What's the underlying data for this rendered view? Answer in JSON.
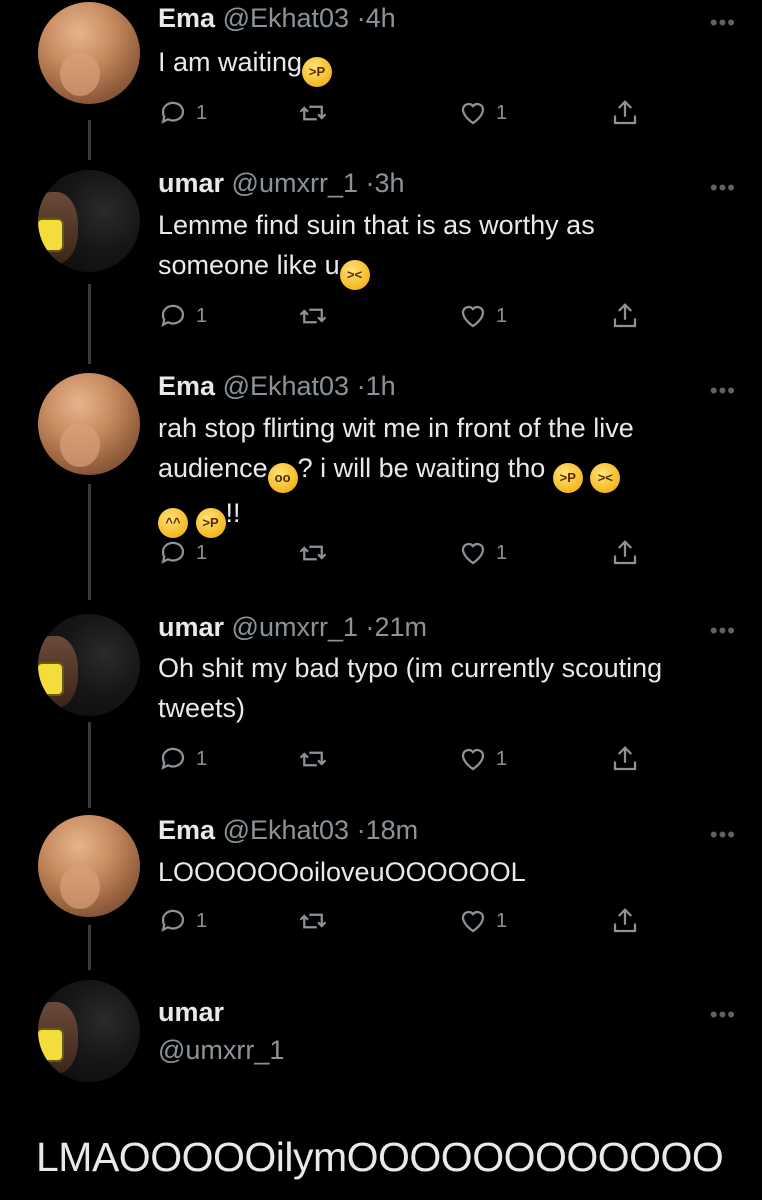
{
  "tweets": [
    {
      "name": "Ema",
      "handle": "@Ekhat03",
      "time": "4h",
      "author": "ema",
      "text": "I am waiting",
      "emojis": [
        "squint-tongue-emoji"
      ],
      "replies": "1",
      "likes": "1"
    },
    {
      "name": "umar",
      "handle": "@umxrr_1",
      "time": "3h",
      "author": "umar",
      "line1": "Lemme find suin that is as worthy as",
      "line2": "someone like u",
      "emojis": [
        "weary-emoji"
      ],
      "replies": "1",
      "likes": "1"
    },
    {
      "name": "Ema",
      "handle": "@Ekhat03",
      "time": "1h",
      "author": "ema",
      "line1": "rah stop flirting wit me in front of the live",
      "line2a": "audience",
      "line2b": "? i will be waiting tho",
      "line3": "!!",
      "emojis": [
        "flushed-emoji",
        "squint-tongue-emoji",
        "tired-emoji",
        "yum-emoji",
        "squint-tongue-emoji"
      ],
      "replies": "1",
      "likes": "1"
    },
    {
      "name": "umar",
      "handle": "@umxrr_1",
      "time": "21m",
      "author": "umar",
      "line1": "Oh shit my bad typo (im currently scouting",
      "line2": "tweets)",
      "replies": "1",
      "likes": "1"
    },
    {
      "name": "Ema",
      "handle": "@Ekhat03",
      "time": "18m",
      "author": "ema",
      "text": "LOOOOOOoiloveuOOOOOOL",
      "replies": "1",
      "likes": "1"
    },
    {
      "name": "umar",
      "handle": "@umxrr_1",
      "author": "umar"
    }
  ],
  "sep": "·",
  "more": "•••",
  "main_tweet_text": "LMAOOOOOilymOOOOOOOOOOOO",
  "colors": {
    "background": "#000000",
    "text": "#e7e9ea",
    "muted": "#8b9399",
    "thread_line": "#3a3a3a"
  }
}
